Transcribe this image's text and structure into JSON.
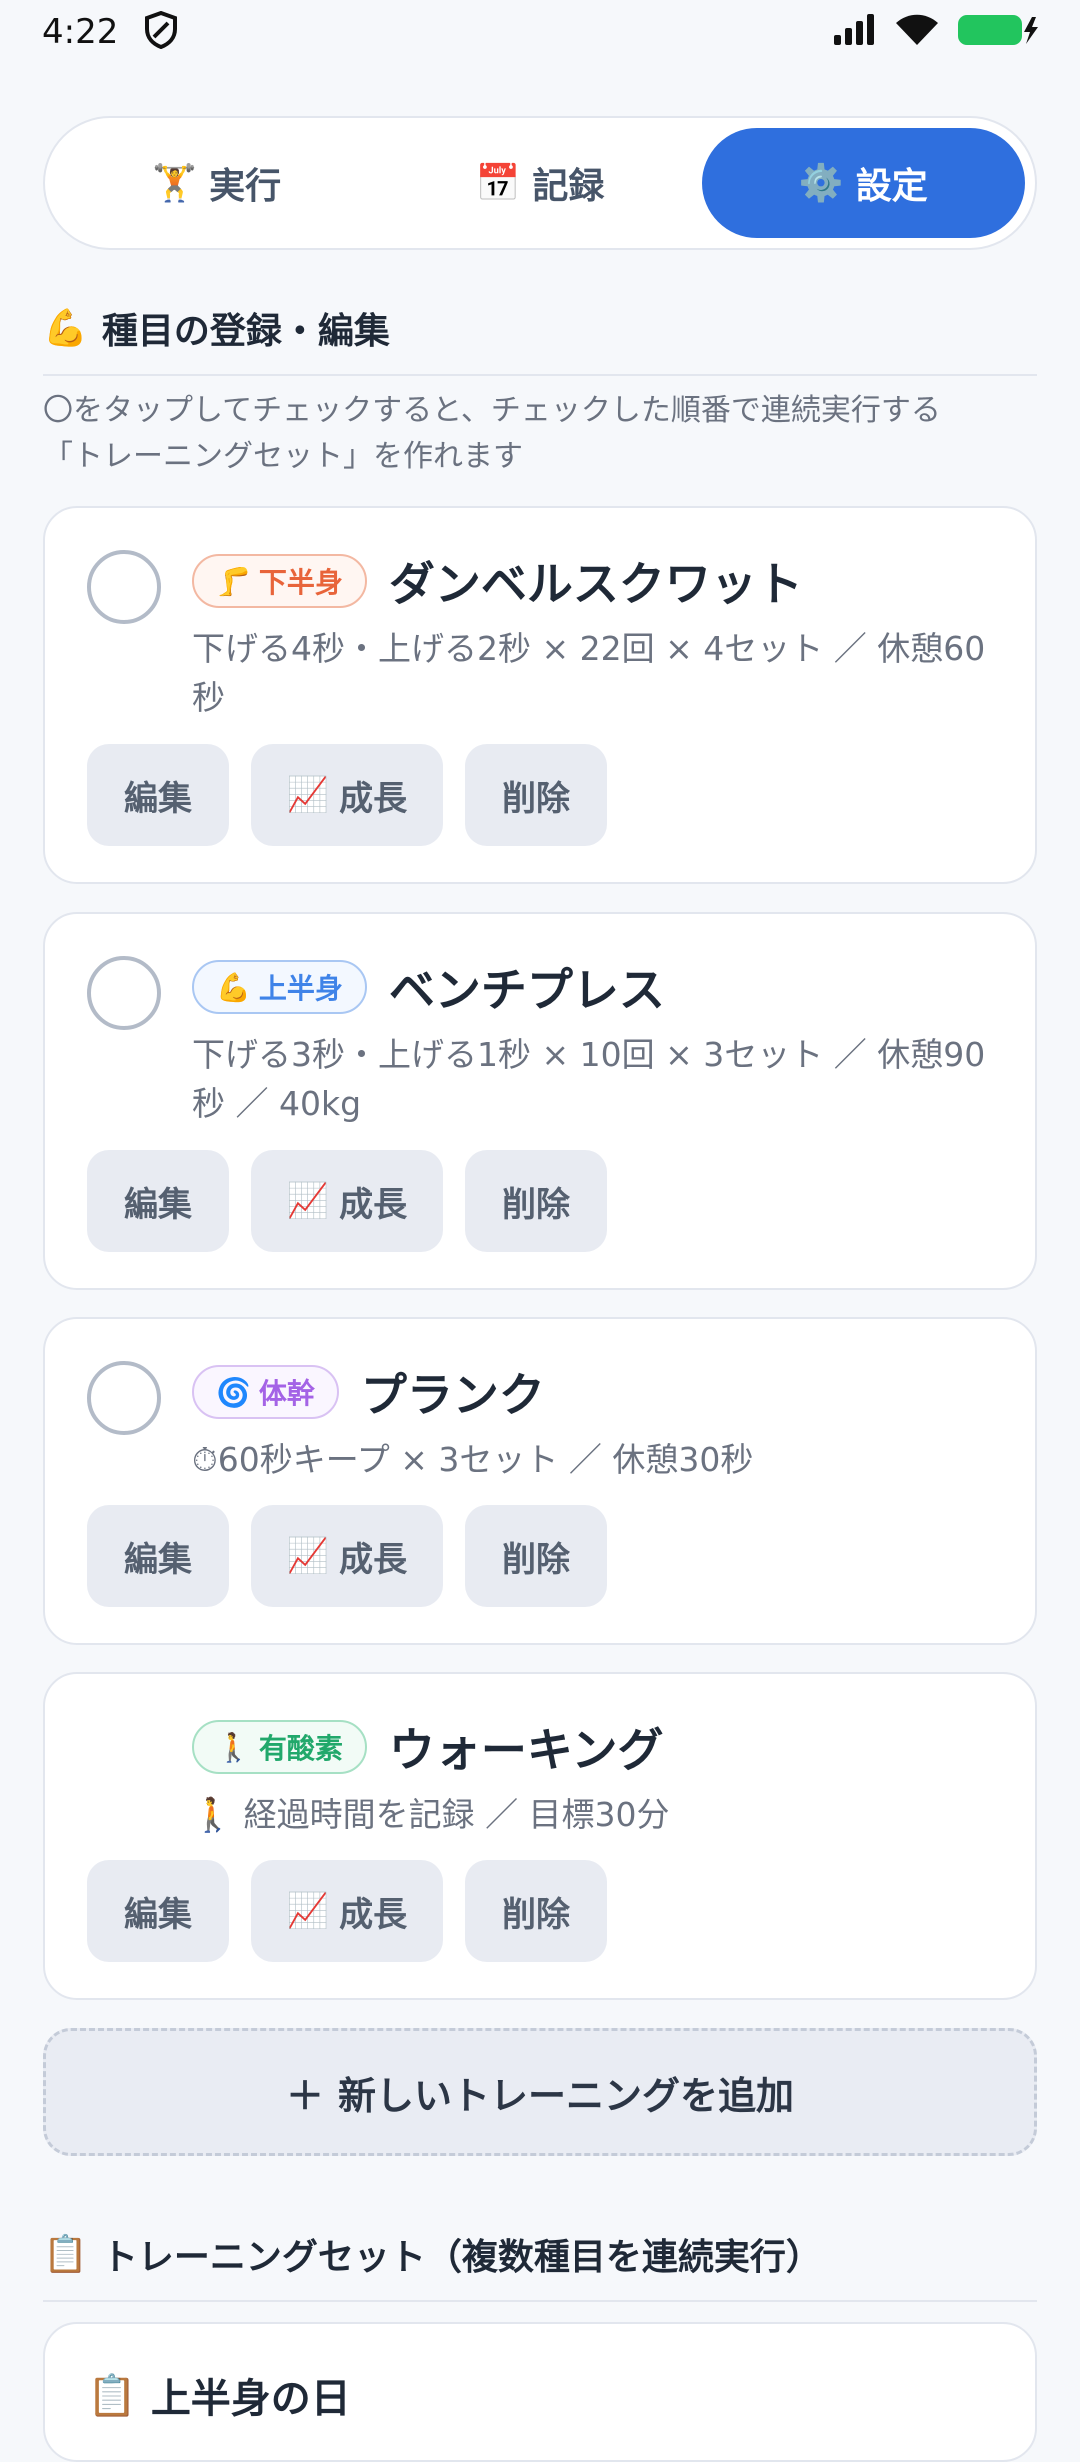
{
  "status": {
    "time": "4:22",
    "shield_icon": "shield-icon",
    "signal_icon": "signal-icon",
    "wifi_icon": "wifi-icon",
    "battery_icon": "battery-charging-icon"
  },
  "tabs": [
    {
      "icon": "🏋",
      "label": "実行",
      "active": false
    },
    {
      "icon": "📅",
      "label": "記録",
      "active": false
    },
    {
      "icon": "⚙️",
      "label": "設定",
      "active": true
    }
  ],
  "exercises_section": {
    "icon": "💪",
    "title": "種目の登録・編集",
    "hint_line1": "〇をタップしてチェックすると、チェックした順番で連続実行する",
    "hint_line2": "「トレーニングセット」を作れます"
  },
  "exercises": [
    {
      "tag_icon": "🦵",
      "tag": "下半身",
      "name": "ダンベルスクワット",
      "detail": "下げる4秒・上げる2秒 × 22回 × 4セット ／ 休憩60秒"
    },
    {
      "tag_icon": "💪",
      "tag": "上半身",
      "name": "ベンチプレス",
      "detail": "下げる3秒・上げる1秒 × 10回 × 3セット ／ 休憩90秒 ／ 40kg"
    },
    {
      "tag_icon": "🌀",
      "tag": "体幹",
      "name": "プランク",
      "detail": "⏱60秒キープ × 3セット ／ 休憩30秒"
    },
    {
      "tag_icon": "🚶",
      "tag": "有酸素",
      "name": "ウォーキング",
      "detail": "🚶 経過時間を記録 ／ 目標30分"
    }
  ],
  "buttons": {
    "edit": "編集",
    "growth_icon": "📈",
    "growth": "成長",
    "delete": "削除"
  },
  "add_button": {
    "icon": "＋",
    "label": "新しいトレーニングを追加"
  },
  "sets_section": {
    "icon": "📋",
    "title": "トレーニングセット（複数種目を連続実行）"
  },
  "sets": [
    {
      "icon": "📋",
      "name": "上半身の日"
    }
  ],
  "colors": {
    "accent": "#2f6fde",
    "background": "#f6f8fb",
    "lower_body": "#e8643a",
    "upper_body": "#3f83e8",
    "core": "#a463e6",
    "cardio": "#21a86b"
  }
}
